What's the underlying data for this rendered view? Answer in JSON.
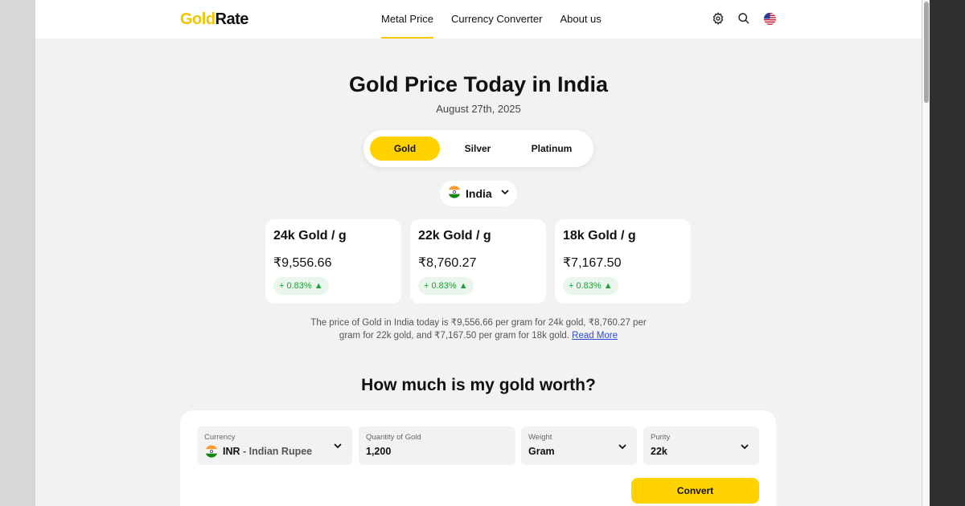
{
  "header": {
    "logo_gold": "Gold",
    "logo_rate": "Rate",
    "nav": [
      "Metal Price",
      "Currency Converter",
      "About us"
    ],
    "icons": [
      "gear-icon",
      "search-icon",
      "us-flag-icon"
    ]
  },
  "hero": {
    "title": "Gold Price Today in India",
    "date": "August 27th, 2025"
  },
  "metals": {
    "options": [
      "Gold",
      "Silver",
      "Platinum"
    ],
    "selected": "Gold"
  },
  "country": {
    "name": "India",
    "flag": "india-flag-icon"
  },
  "cards": [
    {
      "title": "24k Gold / g",
      "price": "₹9,556.66",
      "change": "+ 0.83% ▲"
    },
    {
      "title": "22k Gold / g",
      "price": "₹8,760.27",
      "change": "+ 0.83% ▲"
    },
    {
      "title": "18k Gold / g",
      "price": "₹7,167.50",
      "change": "+ 0.83% ▲"
    }
  ],
  "description": {
    "text": "The price of Gold in India today is ₹9,556.66 per gram for 24k gold, ₹8,760.27 per gram for 22k gold, and ₹7,167.50 per gram for 18k gold.",
    "link": "Read More"
  },
  "calculator": {
    "heading": "How much is my gold worth?",
    "currency": {
      "label": "Currency",
      "code": "INR",
      "separator": " - ",
      "name": "Indian Rupee"
    },
    "quantity": {
      "label": "Quantity of Gold",
      "value": "1,200"
    },
    "weight": {
      "label": "Weight",
      "value": "Gram"
    },
    "purity": {
      "label": "Purity",
      "value": "22k"
    },
    "convert_label": "Convert"
  },
  "colors": {
    "accent": "#ffd200",
    "logo_gold": "#f2c400",
    "positive": "#1e9e3a",
    "link": "#2a4bd7"
  }
}
